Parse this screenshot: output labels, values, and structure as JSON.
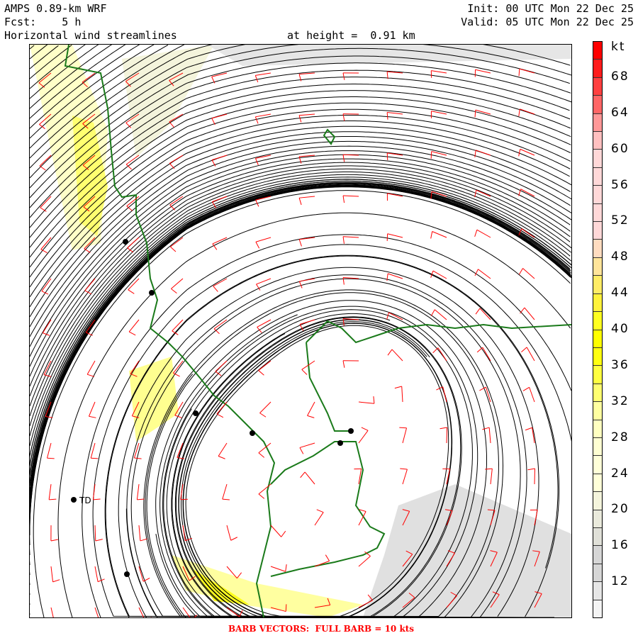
{
  "header": {
    "model": "AMPS 0.89-km WRF",
    "forecast": "Fcst:    5 h",
    "field": "Horizontal wind streamlines",
    "height": "at height =  0.91 km",
    "init": "Init: 00 UTC Mon 22 Dec 25",
    "valid": "Valid: 05 UTC Mon 22 Dec 25"
  },
  "colorbar": {
    "unit": "kt",
    "labels": [
      "68",
      "64",
      "60",
      "56",
      "52",
      "48",
      "44",
      "40",
      "36",
      "32",
      "28",
      "24",
      "20",
      "16",
      "12"
    ],
    "colors": [
      "#ff0000",
      "#ff1c1c",
      "#ff4040",
      "#ff6666",
      "#ff9898",
      "#ffc0c0",
      "#ffd8d8",
      "#ffd8d8",
      "#ffd8d8",
      "#ffd8d8",
      "#ffd8d8",
      "#ffdcc0",
      "#ffe49a",
      "#ffec66",
      "#fff23c",
      "#ffff20",
      "#ffff00",
      "#ffff10",
      "#ffff40",
      "#ffff70",
      "#ffffa0",
      "#ffffc0",
      "#ffffd2",
      "#ffffd8",
      "#ffffd8",
      "#f4f4dc",
      "#eaeadc",
      "#e0e0d8",
      "#d6d6d6",
      "#d6d6d6",
      "#e6e6e6",
      "#f4f4f4"
    ]
  },
  "stations": [
    {
      "label": "TD"
    }
  ],
  "footer": "BARB VECTORS:  FULL BARB = 10 kts",
  "styles": {
    "streamline": "#000000",
    "barb": "#ff0000",
    "coast": "#1a7a1a"
  }
}
